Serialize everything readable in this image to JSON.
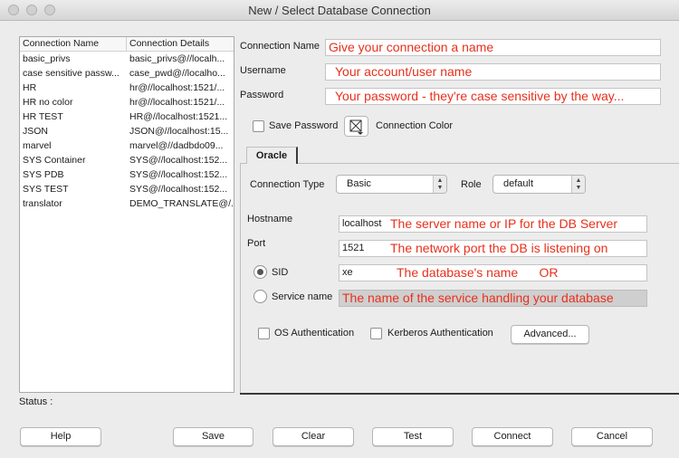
{
  "window": {
    "title": "New / Select Database Connection"
  },
  "connections": {
    "headers": [
      "Connection Name",
      "Connection Details"
    ],
    "rows": [
      [
        "basic_privs",
        "basic_privs@//localh..."
      ],
      [
        "case sensitive passw...",
        "case_pwd@//localho..."
      ],
      [
        "HR",
        "hr@//localhost:1521/..."
      ],
      [
        "HR no color",
        "hr@//localhost:1521/..."
      ],
      [
        "HR TEST",
        "HR@//localhost:1521..."
      ],
      [
        "JSON",
        "JSON@//localhost:15..."
      ],
      [
        "marvel",
        "marvel@//dadbdo09..."
      ],
      [
        "SYS Container",
        "SYS@//localhost:152..."
      ],
      [
        "SYS PDB",
        "SYS@//localhost:152..."
      ],
      [
        "SYS TEST",
        "SYS@//localhost:152..."
      ],
      [
        "translator",
        "DEMO_TRANSLATE@/..."
      ]
    ]
  },
  "form": {
    "name_label": "Connection Name",
    "name_value": "Give your connection a name",
    "username_label": "Username",
    "username_value": "Your account/user name",
    "password_label": "Password",
    "password_value": "Your password - they're case sensitive by the way...",
    "save_password_label": "Save Password",
    "connection_color_label": "Connection Color"
  },
  "tab": {
    "label": "Oracle"
  },
  "oracle": {
    "connection_type_label": "Connection Type",
    "connection_type_value": "Basic",
    "role_label": "Role",
    "role_value": "default",
    "hostname_label": "Hostname",
    "hostname_value": "localhost",
    "hostname_note": "The server name or IP for the DB Server",
    "port_label": "Port",
    "port_value": "1521",
    "port_note": "The network port the DB is listening on",
    "sid_label": "SID",
    "sid_value": "xe",
    "sid_note": "The database's name      OR",
    "service_label": "Service name",
    "service_note": "The name of the service handling your database",
    "os_auth_label": "OS Authentication",
    "kerberos_label": "Kerberos Authentication",
    "advanced_label": "Advanced..."
  },
  "status": {
    "label": "Status :"
  },
  "buttons": {
    "help": "Help",
    "save": "Save",
    "clear": "Clear",
    "test": "Test",
    "connect": "Connect",
    "cancel": "Cancel"
  }
}
